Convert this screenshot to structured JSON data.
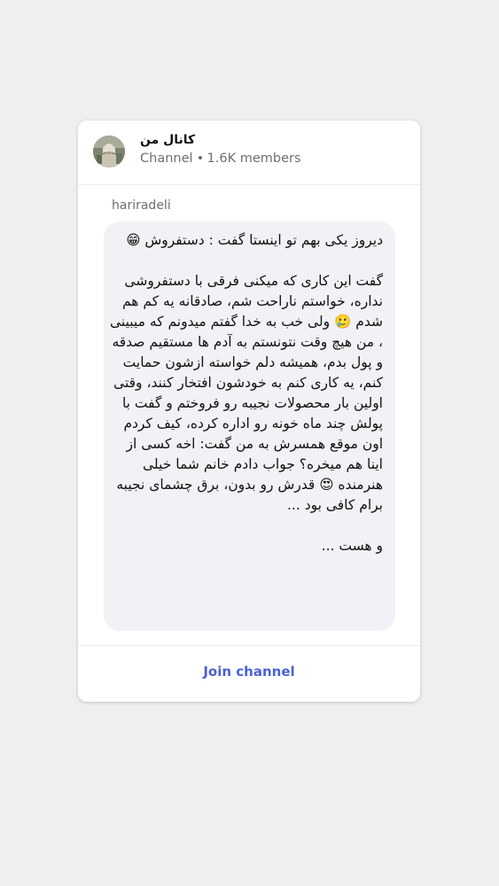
{
  "channel": {
    "title": "کانال من",
    "type": "Channel",
    "members": "1.6K members",
    "avatar_icon": "channel-avatar-photo"
  },
  "post": {
    "author": "hariradeli",
    "text": "دیروز یکی بهم تو اینستا گفت : دستفروش 😁\n\nگفت این کاری که میکنی فرقی با دستفروشی نداره، خواستم ناراحت شم، صادقانه یه کم هم شدم 🥲 ولی خب به خدا گفتم میدونم که میبینی ، من هیچ وقت نتونستم به آدم ها مستقیم صدقه و پول بدم، همیشه دلم خواسته ازشون حمایت کنم، یه کاری کنم به خودشون افتخار کنند، وقتی اولین بار محصولات نجیبه رو فروختم و گفت با پولش چند ماه خونه رو اداره کرده، کیف کردم اون موقع همسرش به من گفت: اخه کسی از اینا هم میخره؟ جواب دادم خانم شما خیلی هنرمنده 😍 قدرش رو بدون، برق چشمای نجیبه برام کافی بود ...\n\nو هست ..."
  },
  "footer": {
    "join_label": "Join channel",
    "accent_color": "#4a62d6"
  }
}
